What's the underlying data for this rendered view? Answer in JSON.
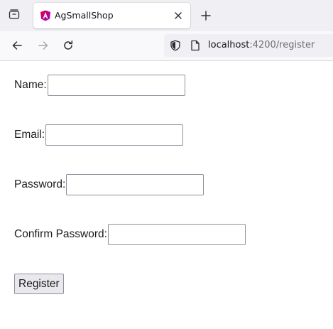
{
  "browser": {
    "tab": {
      "title": "AgSmallShop",
      "favicon": "angular-logo-icon"
    },
    "url": {
      "host": "localhost",
      "rest": ":4200/register"
    },
    "icons": {
      "tab_list": "tab-list-icon",
      "close_tab": "close-icon",
      "new_tab": "plus-icon",
      "back": "arrow-left-icon",
      "forward": "arrow-right-icon",
      "reload": "reload-icon",
      "tracking_protection": "shield-icon",
      "page_info": "page-icon"
    }
  },
  "form": {
    "fields": [
      {
        "label": "Name:",
        "value": ""
      },
      {
        "label": "Email:",
        "value": ""
      },
      {
        "label": "Password:",
        "value": ""
      },
      {
        "label": "Confirm Password:",
        "value": ""
      }
    ],
    "submit_label": "Register"
  },
  "colors": {
    "tabstrip_bg": "#f0f0f4",
    "navbar_bg": "#f9f9fb",
    "angular_red": "#dd0031",
    "angular_magenta": "#c3002f"
  }
}
